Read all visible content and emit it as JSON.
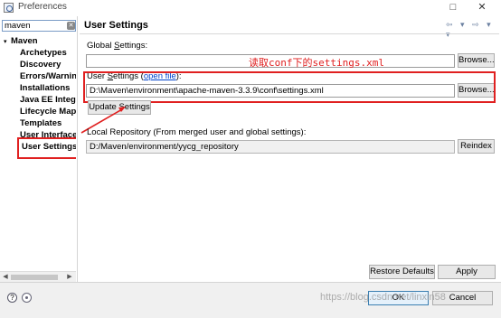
{
  "window": {
    "title": "Preferences",
    "controls": [
      "□",
      "✕"
    ]
  },
  "sidebar": {
    "filter_value": "maven",
    "filter_clear_glyph": "✕",
    "root_twisty": "▾",
    "root_label": "Maven",
    "items": [
      {
        "label": "Archetypes"
      },
      {
        "label": "Discovery"
      },
      {
        "label": "Errors/Warnin"
      },
      {
        "label": "Installations"
      },
      {
        "label": "Java EE Integr"
      },
      {
        "label": "Lifecycle Map"
      },
      {
        "label": "Templates"
      },
      {
        "label": "User Interface"
      },
      {
        "label": "User Settings"
      }
    ]
  },
  "page": {
    "title": "User Settings",
    "nav_glyphs": "⇦ ▾ ⇨ ▾ ▾"
  },
  "global_settings": {
    "label_prefix": "Global ",
    "label_mnemonic": "S",
    "label_suffix": "ettings:",
    "value": "",
    "browse_label": "Browse..."
  },
  "user_settings": {
    "label_prefix": "User ",
    "label_mnemonic": "S",
    "label_suffix": "ettings (",
    "link_text": "open file",
    "label_end": "):",
    "value": "D:\\Maven\\environment\\apache-maven-3.3.9\\conf\\settings.xml",
    "browse_label": "Browse...",
    "update_label": "Update Settings"
  },
  "local_repository": {
    "label": "Local Repository (From merged user and global settings):",
    "value": "D:/Maven/environment/yycg_repository",
    "reindex_label": "Reindex"
  },
  "annotation": {
    "text": "读取conf下的settings.xml",
    "color": "#e02020"
  },
  "actions": {
    "restore_defaults": "Restore Defaults",
    "apply": "Apply",
    "ok": "OK",
    "cancel": "Cancel",
    "help_glyph": "?"
  },
  "watermark": "https://blog.csdn.net/linxin58"
}
